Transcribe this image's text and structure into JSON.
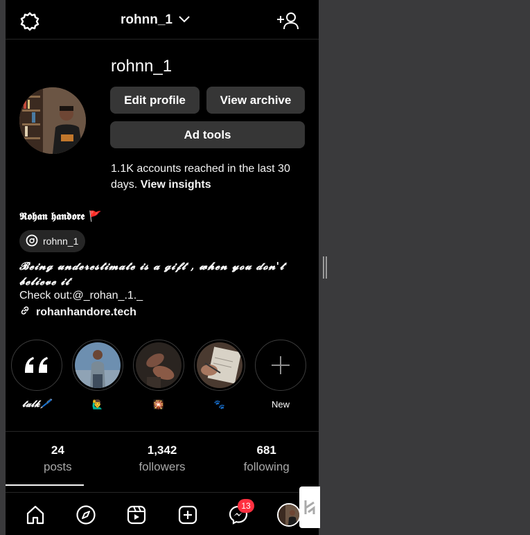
{
  "header": {
    "username": "rohnn_1",
    "settings_icon": "gear-icon",
    "add_user_icon": "add-user-icon"
  },
  "profile": {
    "name": "rohnn_1",
    "edit_label": "Edit profile",
    "archive_label": "View archive",
    "adtools_label": "Ad tools",
    "insights_text": "1.1K accounts reached in the last 30 days. ",
    "insights_link": "View insights",
    "display_name": "𝕽𝖔𝖍𝖆𝖓 𝖍𝖆𝖓𝖉𝖔𝖗𝖊",
    "display_flag": "🚩",
    "threads_handle": "rohnn_1",
    "bio_quote": "𝓑𝓮𝓲𝓷𝓰 𝓾𝓷𝓭𝓮𝓻𝓮𝓼𝓽𝓲𝓶𝓪𝓽𝓮 𝓲𝓼 𝓪 𝓰𝓲𝓯𝓽 , 𝔀𝓱𝓮𝓷 𝔂𝓸𝓾 𝓭𝓸𝓷'𝓽 𝓫𝓮𝓵𝓲𝓮𝓿𝓮 𝓲𝓽",
    "bio_check": "Check out:@_rohan_.1._",
    "bio_link": "rohanhandore.tech"
  },
  "highlights": [
    {
      "label": "𝓽𝓪𝓵𝓴🖊️",
      "kind": "quote"
    },
    {
      "label": "🙋‍♂️",
      "kind": "photo-man"
    },
    {
      "label": "🎇",
      "kind": "photo-hands"
    },
    {
      "label": "🐾",
      "kind": "photo-book"
    },
    {
      "label": "New",
      "kind": "new"
    }
  ],
  "stats": {
    "posts_num": "24",
    "posts_lbl": "posts",
    "followers_num": "1,342",
    "followers_lbl": "followers",
    "following_num": "681",
    "following_lbl": "following"
  },
  "nav": {
    "messages_badge": "13",
    "icons": [
      "home-icon",
      "explore-icon",
      "reels-icon",
      "create-icon",
      "messenger-icon",
      "profile-avatar"
    ]
  },
  "colors": {
    "background": "#000000",
    "button": "#363636",
    "badge": "#ff3040",
    "muted_text": "#a8a8a8"
  }
}
